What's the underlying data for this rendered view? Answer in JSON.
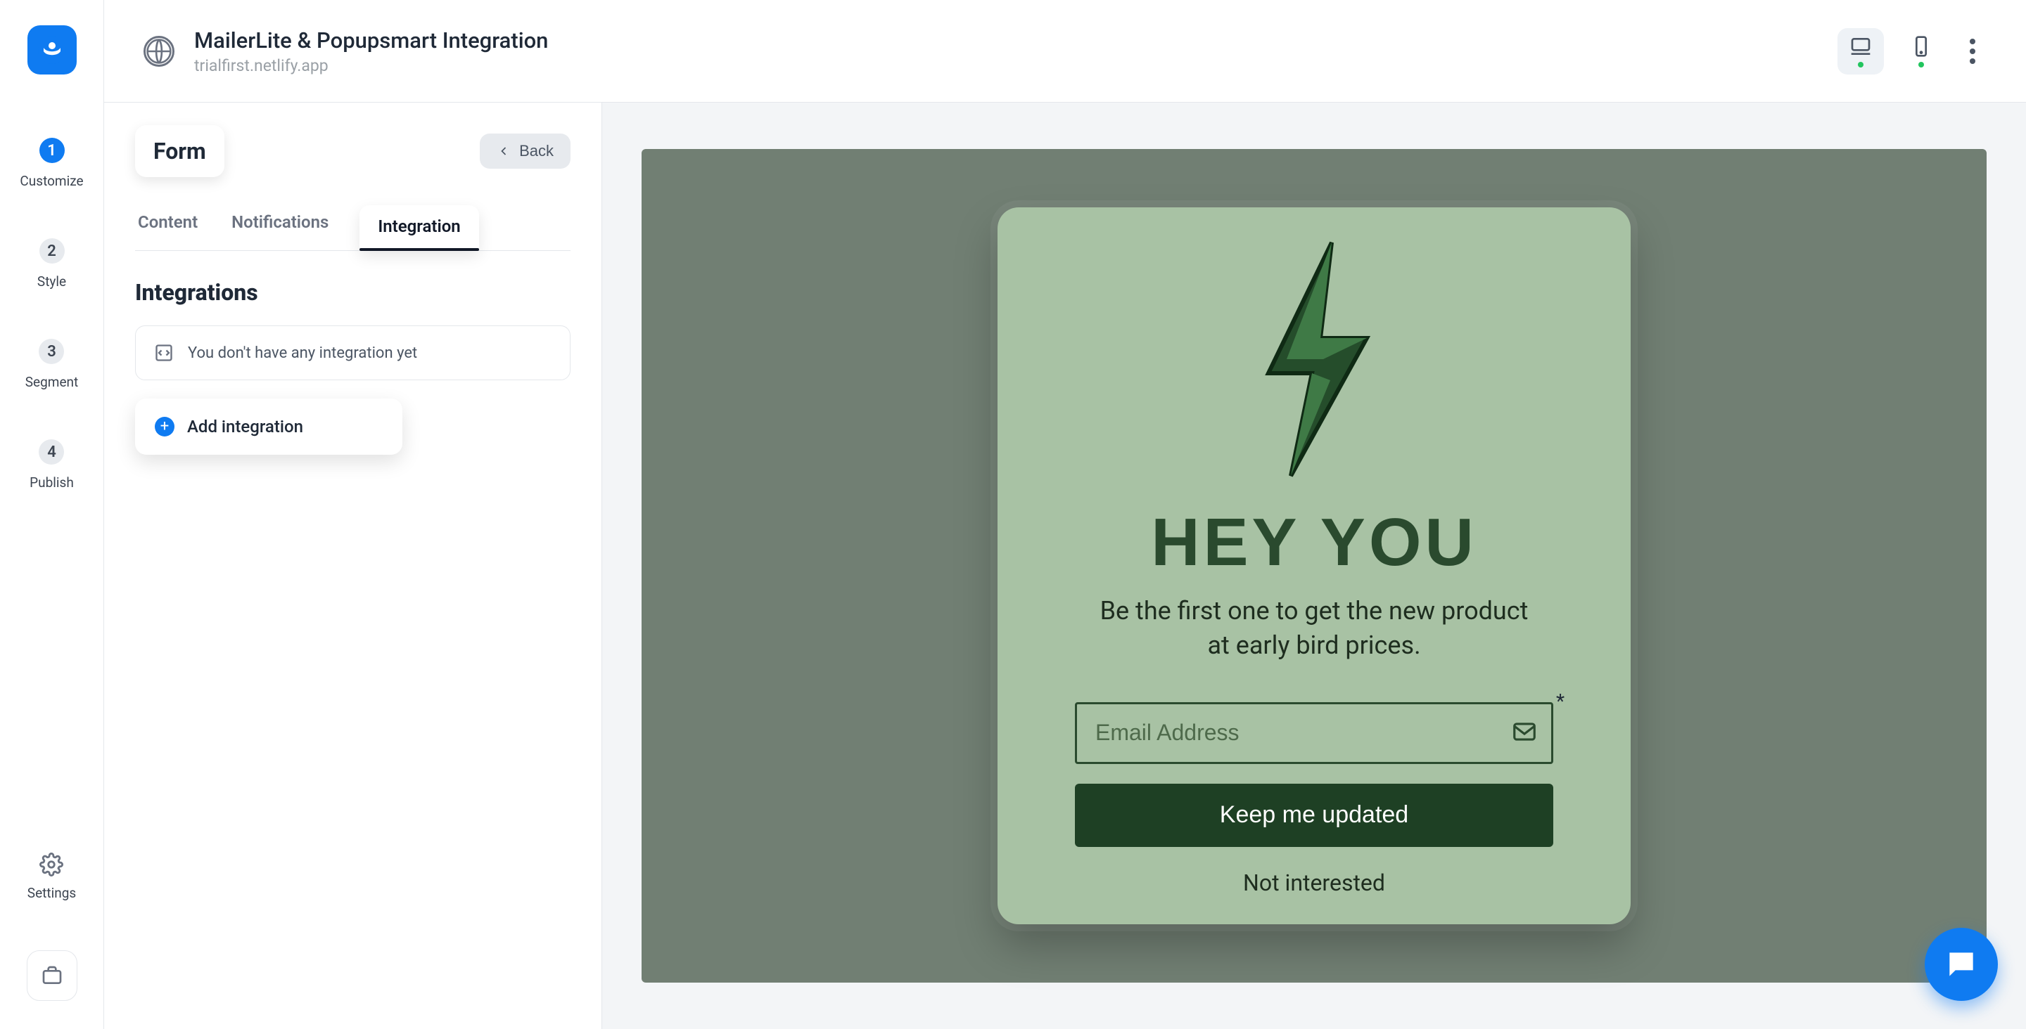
{
  "header": {
    "title": "MailerLite & Popupsmart Integration",
    "subtitle": "trialfirst.netlify.app"
  },
  "rail": {
    "steps": [
      {
        "num": "1",
        "label": "Customize",
        "active": true
      },
      {
        "num": "2",
        "label": "Style",
        "active": false
      },
      {
        "num": "3",
        "label": "Segment",
        "active": false
      },
      {
        "num": "4",
        "label": "Publish",
        "active": false
      }
    ],
    "settings_label": "Settings"
  },
  "panel": {
    "chip": "Form",
    "back": "Back",
    "tabs": {
      "content": "Content",
      "notifications": "Notifications",
      "integration": "Integration"
    },
    "section_title": "Integrations",
    "empty_msg": "You don't have any integration yet",
    "add_label": "Add integration"
  },
  "preview": {
    "heading": "HEY YOU",
    "subtext": "Be the first one to get the new product at early bird prices.",
    "email_placeholder": "Email Address",
    "asterisk": "*",
    "cta": "Keep me updated",
    "dismiss": "Not interested"
  },
  "colors": {
    "brand": "#0f7bf1",
    "popup_bg": "#a8c2a4",
    "popup_dark": "#1e4024",
    "stage_bg": "#717f73"
  }
}
